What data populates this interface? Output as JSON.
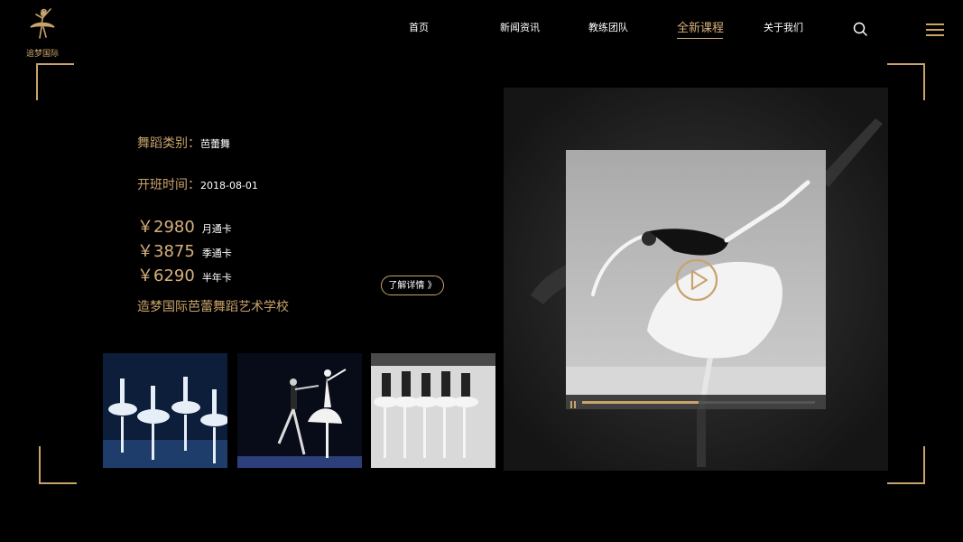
{
  "brand": {
    "name": "追梦国际",
    "accent": "#c9a36b"
  },
  "nav": {
    "items": [
      "首页",
      "新闻资讯",
      "教练团队",
      "全新课程",
      "关于我们"
    ],
    "active": "全新课程",
    "search_icon": "search-icon",
    "menu_icon": "hamburger-menu-icon"
  },
  "course": {
    "category_label": "舞蹈类别：",
    "category_value": "芭蕾舞",
    "start_label": "开班时间：",
    "start_value": "2018-08-01",
    "prices": [
      {
        "amount": "￥2980",
        "unit": "月通卡"
      },
      {
        "amount": "￥3875",
        "unit": "季通卡"
      },
      {
        "amount": "￥6290",
        "unit": "半年卡"
      }
    ],
    "school": "造梦国际芭蕾舞蹈艺术学校",
    "detail_button": "了解详情 》"
  },
  "video": {
    "progress": 0.5,
    "play_icon": "play-icon",
    "pause_icon": "pause-icon"
  }
}
